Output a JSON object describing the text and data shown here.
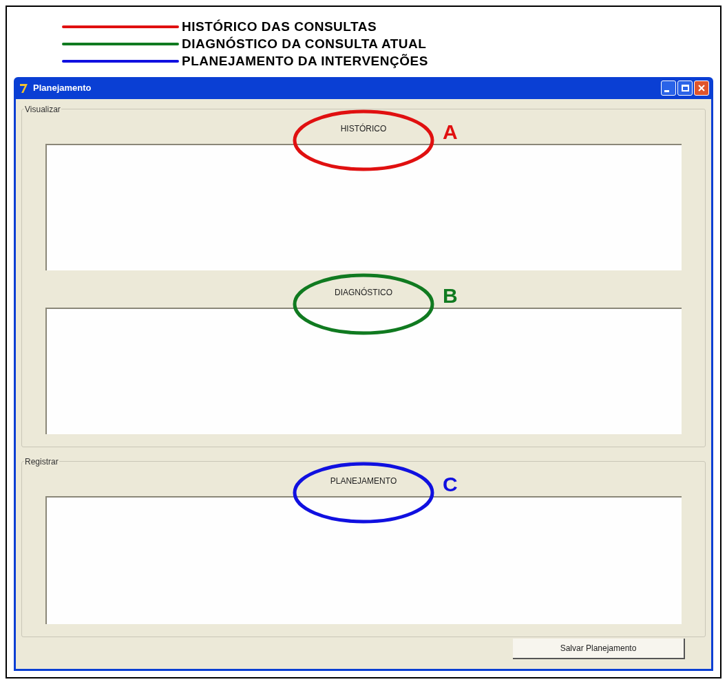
{
  "legend": [
    {
      "label": "HISTÓRICO DAS CONSULTAS",
      "color": "#e01010"
    },
    {
      "label": "DIAGNÓSTICO DA CONSULTA ATUAL",
      "color": "#107a20"
    },
    {
      "label": "PLANEJAMENTO DA INTERVENÇÕES",
      "color": "#1010e0"
    }
  ],
  "window": {
    "title": "Planejamento"
  },
  "groups": [
    {
      "label": "Visualizar",
      "sections": [
        {
          "label": "HISTÓRICO",
          "annotation": "A",
          "color": "#e01010"
        },
        {
          "label": "DIAGNÓSTICO",
          "annotation": "B",
          "color": "#107a20"
        }
      ]
    },
    {
      "label": "Registrar",
      "sections": [
        {
          "label": "PLANEJAMENTO",
          "annotation": "C",
          "color": "#1010e0"
        }
      ]
    }
  ],
  "button": "Salvar Planejamento"
}
